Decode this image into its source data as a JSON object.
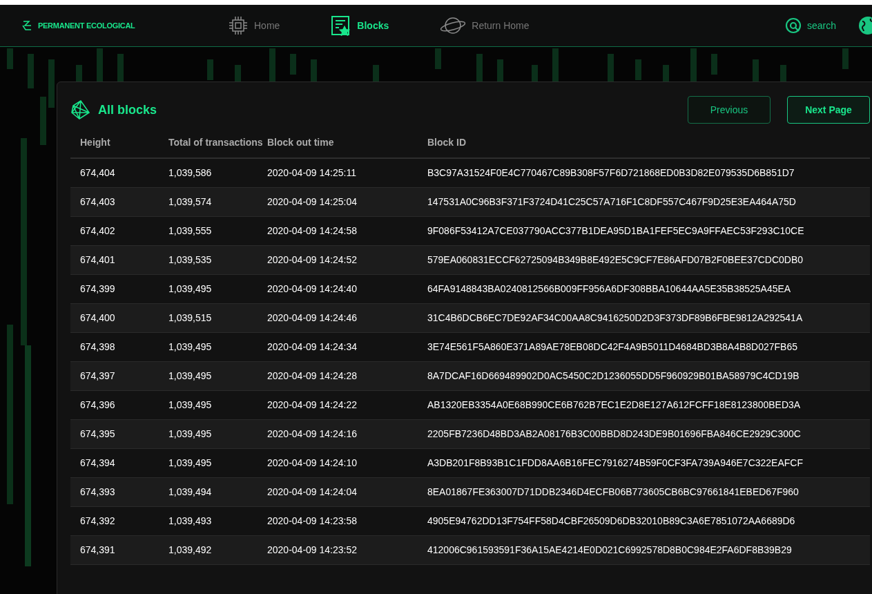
{
  "brand": "PERMANENT ECOLOGICAL",
  "nav": [
    {
      "label": "Home",
      "kind": "chip",
      "selected": false
    },
    {
      "label": "Blocks",
      "kind": "blocks",
      "selected": true
    },
    {
      "label": "Return Home",
      "kind": "planet",
      "selected": false
    }
  ],
  "search": {
    "label": "search"
  },
  "panel": {
    "title": "All blocks",
    "buttons": [
      {
        "label": "Previous",
        "kind": "secondary"
      },
      {
        "label": "Next Page",
        "kind": "primary"
      }
    ],
    "table": {
      "columns": [
        "Height",
        "Total of transactions",
        "Block out time",
        "Block ID"
      ],
      "rows": [
        [
          "674,404",
          "1,039,586",
          "2020-04-09 14:25:11",
          "B3C97A31524F0E4C770467C89B308F57F6D721868ED0B3D82E079535D6B851D7"
        ],
        [
          "674,403",
          "1,039,574",
          "2020-04-09 14:25:04",
          "147531A0C96B3F371F3724D41C25C57A716F1C8DF557C467F9D25E3EA464A75D"
        ],
        [
          "674,402",
          "1,039,555",
          "2020-04-09 14:24:58",
          "9F086F53412A7CE037790ACC377B1DEA95D1BA1FEF5EC9A9FFAEC53F293C10CE"
        ],
        [
          "674,401",
          "1,039,535",
          "2020-04-09 14:24:52",
          "579EA060831ECCF62725094B349B8E492E5C9CF7E86AFD07B2F0BEE37CDC0DB0"
        ],
        [
          "674,399",
          "1,039,495",
          "2020-04-09 14:24:40",
          "64FA9148843BA0240812566B009FF956A6DF308BBA10644AA5E35B38525A45EA"
        ],
        [
          "674,400",
          "1,039,515",
          "2020-04-09 14:24:46",
          "31C4B6DCB6EC7DE92AF34C00AA8C9416250D2D3F373DF89B6FBE9812A292541A"
        ],
        [
          "674,398",
          "1,039,495",
          "2020-04-09 14:24:34",
          "3E74E561F5A860E371A89AE78EB08DC42F4A9B5011D4684BD3B8A4B8D027FB65"
        ],
        [
          "674,397",
          "1,039,495",
          "2020-04-09 14:24:28",
          "8A7DCAF16D669489902D0AC5450C2D1236055DD5F960929B01BA58979C4CD19B"
        ],
        [
          "674,396",
          "1,039,495",
          "2020-04-09 14:24:22",
          "AB1320EB3354A0E68B990CE6B762B7EC1E2D8E127A612FCFF18E8123800BED3A"
        ],
        [
          "674,395",
          "1,039,495",
          "2020-04-09 14:24:16",
          "2205FB7236D48BD3AB2A08176B3C00BBD8D243DE9B01696FBA846CE2929C300C"
        ],
        [
          "674,394",
          "1,039,495",
          "2020-04-09 14:24:10",
          "A3DB201F8B93B1C1FDD8AA6B16FEC7916274B59F0CF3FA739A946E7C322EAFCF"
        ],
        [
          "674,393",
          "1,039,494",
          "2020-04-09 14:24:04",
          "8EA01867FE363007D71DDB2346D4ECFB06B773605CB6BC97661841EBED67F960"
        ],
        [
          "674,392",
          "1,039,493",
          "2020-04-09 14:23:58",
          "4905E94762DD13F754FF58D4CBF26509D6DB32010B89C3A6E7851072AA6689D6"
        ],
        [
          "674,391",
          "1,039,492",
          "2020-04-09 14:23:52",
          "412006C961593591F36A15AE4214E0D021C6992578D8B0C984E2FA6DF8B39B29"
        ]
      ]
    }
  }
}
